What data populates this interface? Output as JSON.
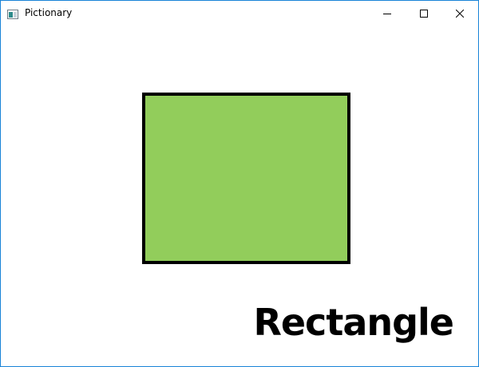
{
  "window": {
    "title": "Pictionary",
    "icon": "app-window-icon"
  },
  "caption_buttons": {
    "minimize_icon": "minimize-icon",
    "maximize_icon": "maximize-icon",
    "close_icon": "close-icon"
  },
  "canvas": {
    "shape": {
      "type": "rectangle",
      "fill": "#92cd5b",
      "stroke": "#000000"
    },
    "word": "Rectangle"
  }
}
